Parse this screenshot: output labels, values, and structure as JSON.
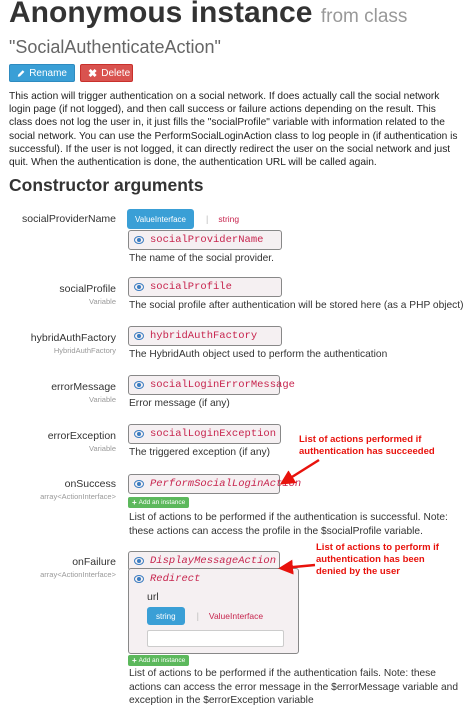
{
  "header": {
    "title": "Anonymous instance",
    "title_suffix": "from class",
    "class_name": "\"SocialAuthenticateAction\""
  },
  "actions": {
    "rename_label": "Rename",
    "delete_label": "Delete"
  },
  "description": "This action will trigger authentication on a social network. If does actually call the social network login page (if not logged), and then call success or failure actions depending on the result. This class does not log the user in, it just fills the \"socialProfile\" variable with information related to the social network. You can use the PerformSocialLoginAction class to log people in (if authentication is successful). If the user is not logged, it can directly redirect the user on the social network and just quit. When the authentication is done, the authentication URL will be called again.",
  "section_title": "Constructor arguments",
  "arguments": [
    {
      "name": "socialProviderName",
      "type": "",
      "tabs": [
        "ValueInterface",
        "string"
      ],
      "value": "socialProviderName",
      "help": "The name of the social provider."
    },
    {
      "name": "socialProfile",
      "type": "Variable",
      "value": "socialProfile",
      "help": "The social profile after authentication will be stored here (as a PHP object)"
    },
    {
      "name": "hybridAuthFactory",
      "type": "HybridAuthFactory",
      "value": "hybridAuthFactory",
      "help": "The HybridAuth object used to perform the authentication"
    },
    {
      "name": "errorMessage",
      "type": "Variable",
      "value": "socialLoginErrorMessage",
      "help": "Error message (if any)"
    },
    {
      "name": "errorException",
      "type": "Variable",
      "value": "socialLoginException",
      "help": "The triggered exception (if any)"
    },
    {
      "name": "onSuccess",
      "type": "array<ActionInterface>",
      "value": "PerformSocialLoginAction",
      "add_label": "Add an instance",
      "help": "List of actions to be performed if the authentication is successful. Note: these actions can access the profile in the $socialProfile variable."
    },
    {
      "name": "onFailure",
      "type": "array<ActionInterface>",
      "value": "DisplayMessageAction",
      "nested_value": "Redirect",
      "nested_param": "url",
      "nested_tabs": [
        "string",
        "ValueInterface"
      ],
      "add_label": "Add an instance",
      "help": "List of actions to be performed if the authentication fails. Note: these actions can access the error message in the $errorMessage variable and exception in the $errorException variable"
    }
  ],
  "annotations": {
    "success": "List of actions performed if authentication has succeeded",
    "failure": "List of actions to perform if authentication has been denied by the user"
  },
  "colors": {
    "primary": "#3a9fd6",
    "danger": "#d9534f",
    "success": "#5cb85c",
    "code": "#c7254e",
    "annotation": "#e8120c"
  }
}
